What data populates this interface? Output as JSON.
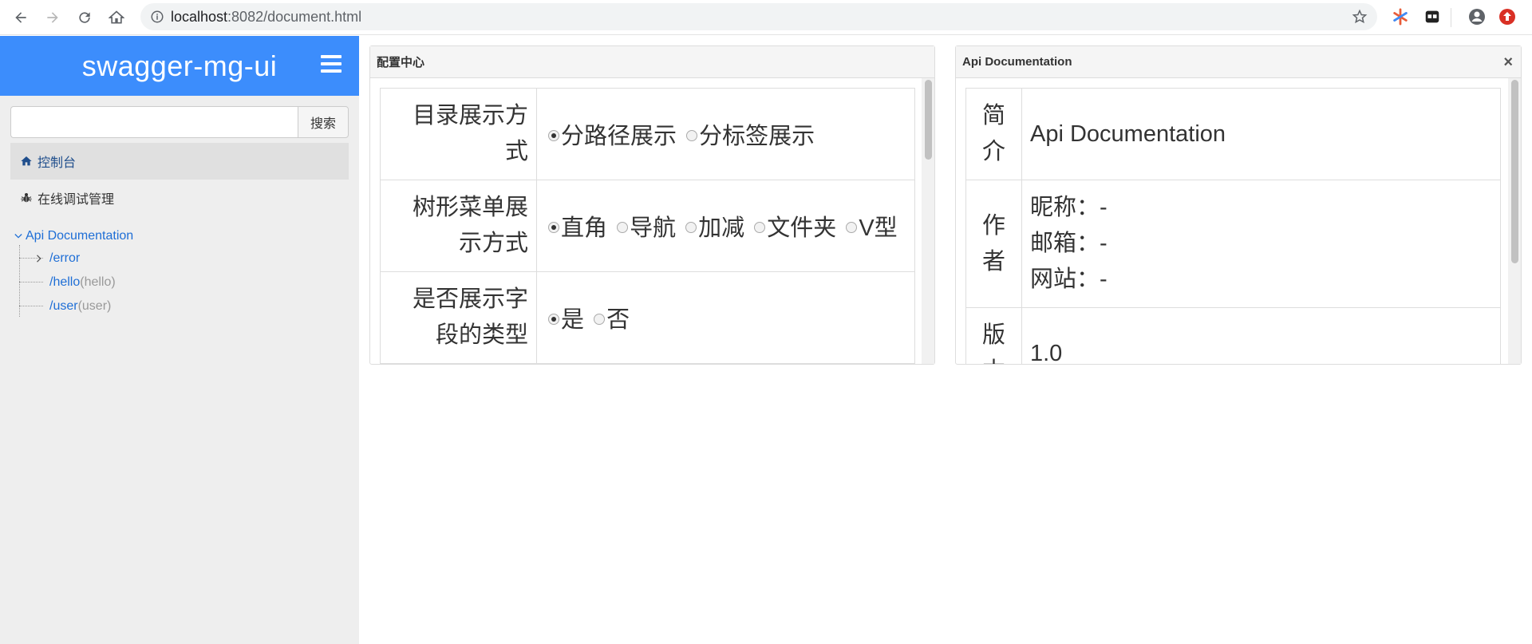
{
  "browser": {
    "url_host": "localhost",
    "url_path": ":8082/document.html"
  },
  "sidebar": {
    "brand": "swagger-mg-ui",
    "search_button": "搜索",
    "search_placeholder": "",
    "menu": [
      {
        "label": "控制台",
        "icon": "home-icon"
      },
      {
        "label": "在线调试管理",
        "icon": "bug-icon"
      }
    ],
    "tree": {
      "root": "Api Documentation",
      "children": [
        {
          "path": "/error",
          "tag": ""
        },
        {
          "path": "/hello",
          "tag": "(hello)"
        },
        {
          "path": "/user",
          "tag": "(user)"
        }
      ]
    }
  },
  "config_panel": {
    "title": "配置中心",
    "rows": [
      {
        "label": "目录展示方式",
        "options": [
          "分路径展示",
          "分标签展示"
        ],
        "selected": "分路径展示"
      },
      {
        "label": "树形菜单展示方式",
        "options": [
          "直角",
          "导航",
          "加减",
          "文件夹",
          "V型"
        ],
        "selected": "直角"
      },
      {
        "label": "是否展示字段的类型",
        "options": [
          "是",
          "否"
        ],
        "selected": "是"
      }
    ]
  },
  "doc_panel": {
    "title": "Api Documentation",
    "rows": {
      "intro_label": "简介",
      "intro_value": "Api Documentation",
      "author_label": "作者",
      "author_nick": "昵称：-",
      "author_email": "邮箱：-",
      "author_site": "网站：-",
      "version_label": "版本",
      "version_value": "1.0"
    }
  }
}
